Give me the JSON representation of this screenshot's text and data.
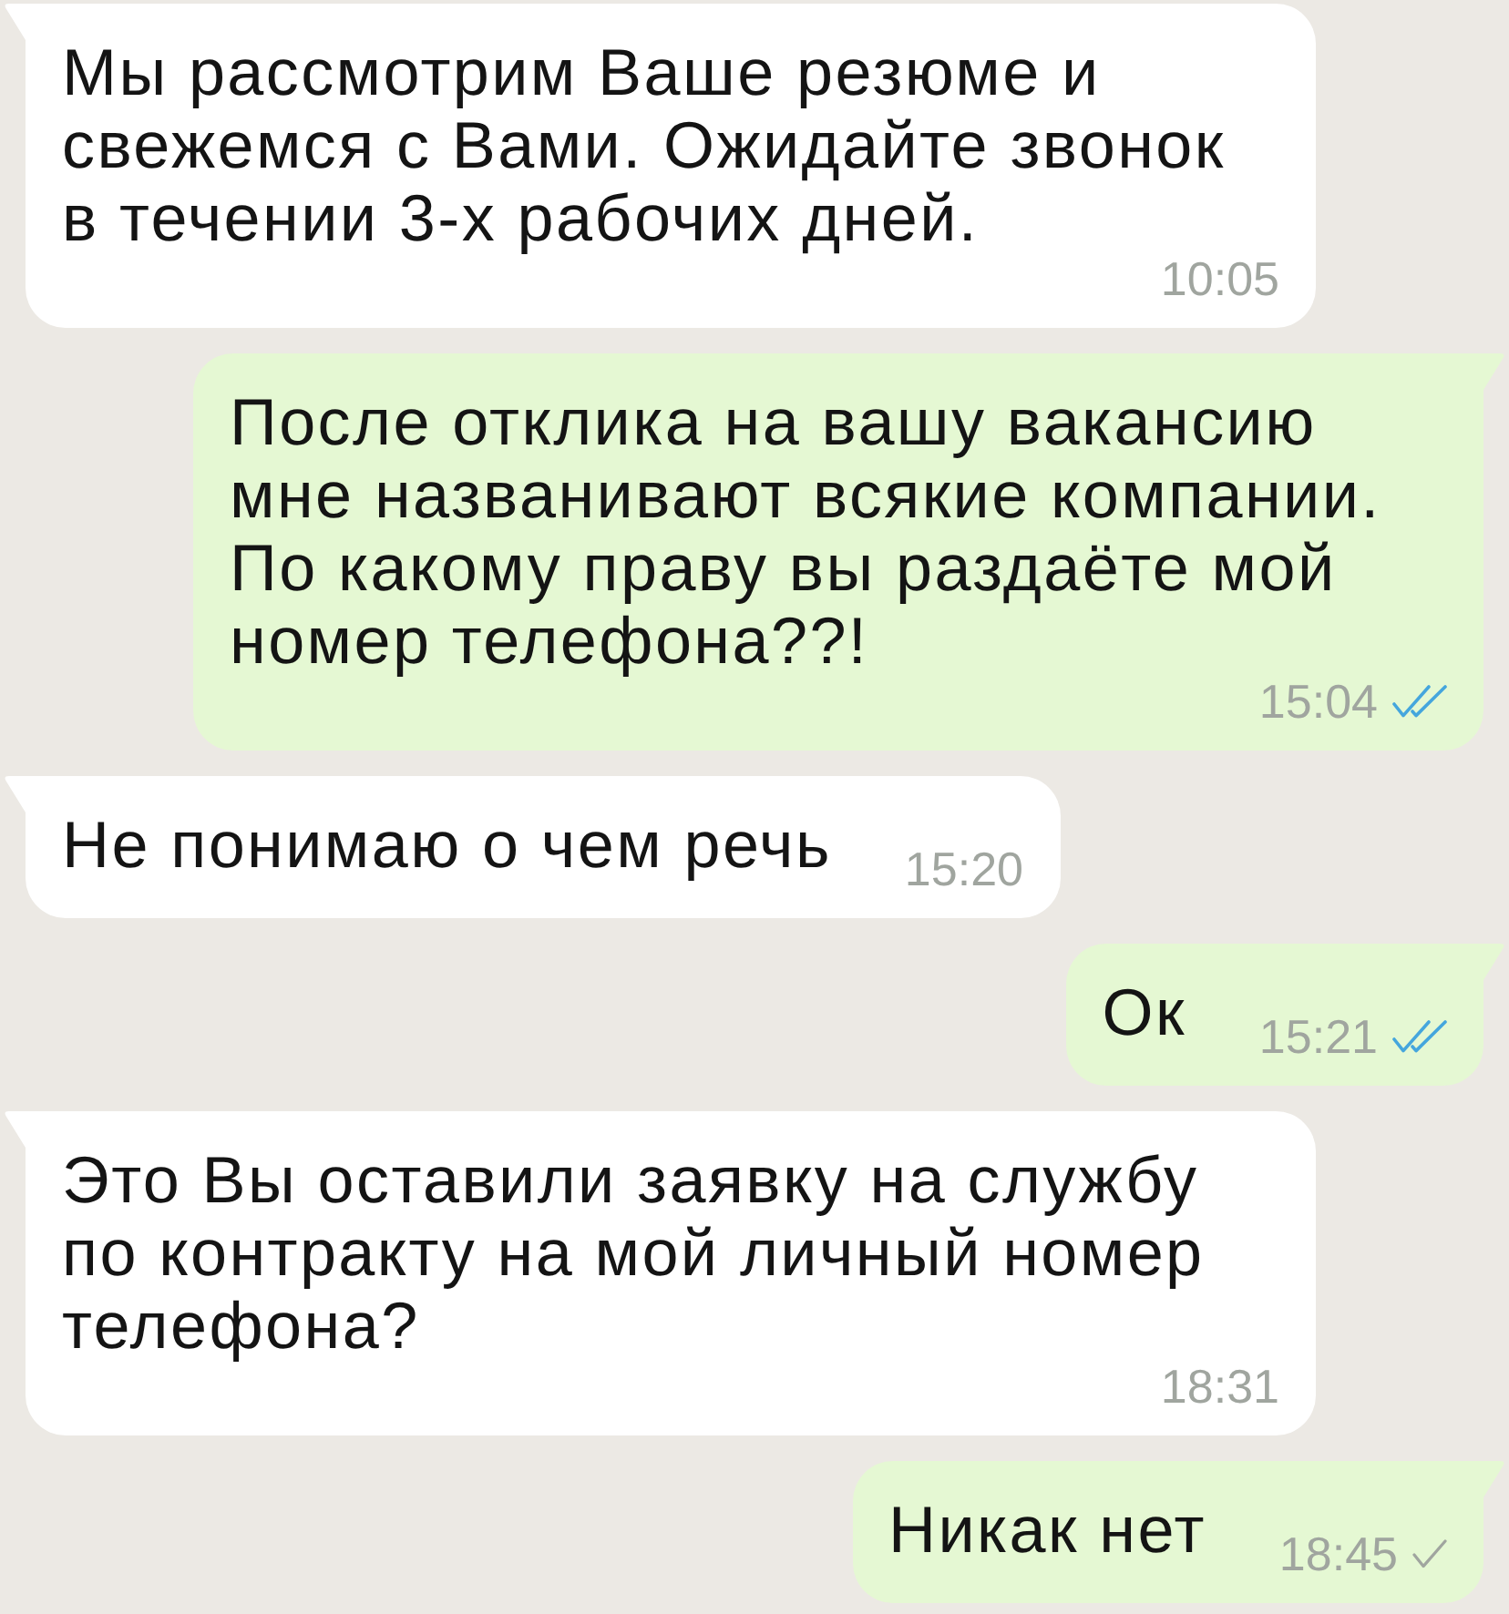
{
  "messages": [
    {
      "kind": "incoming",
      "text": "Мы рассмотрим Ваше резюме и свежемся с Вами. Ожидайте звонок в течении 3-х рабочих дней.",
      "time": "10:05"
    },
    {
      "kind": "outgoing",
      "text": "После отклика на вашу вакансию мне названивают всякие компании. По какому праву вы раздаёте мой номер телефона??!",
      "time": "15:04",
      "delivered": true,
      "read": true
    },
    {
      "kind": "incoming",
      "text": "Не понимаю о чем речь",
      "time": "15:20"
    },
    {
      "kind": "outgoing",
      "text": "Ок",
      "time": "15:21",
      "delivered": true,
      "read": true
    },
    {
      "kind": "incoming",
      "text": "Это Вы оставили заявку на службу по контракту на мой личный номер телефона?",
      "time": "18:31"
    },
    {
      "kind": "outgoing",
      "text": "Никак нет",
      "time": "18:45",
      "delivered": false,
      "read": false
    }
  ]
}
